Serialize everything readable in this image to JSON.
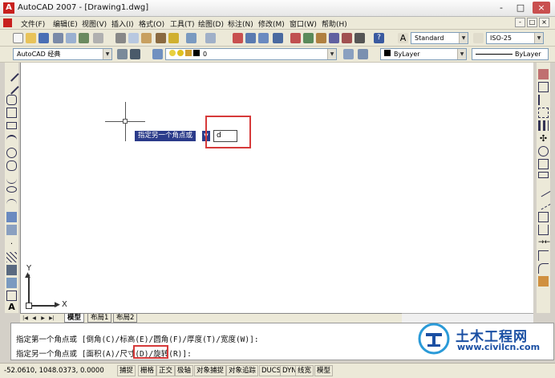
{
  "window": {
    "title": "AutoCAD 2007 - [Drawing1.dwg]",
    "app_icon": "autocad-a-icon",
    "controls": [
      "-",
      "□",
      "×"
    ]
  },
  "menu": {
    "items": [
      "文件(F)",
      "编辑(E)",
      "视图(V)",
      "插入(I)",
      "格式(O)",
      "工具(T)",
      "绘图(D)",
      "标注(N)",
      "修改(M)",
      "窗口(W)",
      "帮助(H)"
    ],
    "doc_controls": [
      "-",
      "□",
      "×"
    ]
  },
  "standard_toolbar": {
    "text_style": "Standard",
    "dim_style": "ISO-25"
  },
  "layers_toolbar": {
    "workspace": "AutoCAD 经典",
    "layer": "0",
    "color": "ByLayer",
    "linetype": "ByLayer"
  },
  "drawing": {
    "prompt_tooltip": "指定另一个角点或",
    "dynamic_input_value": "d"
  },
  "ucs": {
    "x_label": "X",
    "y_label": "Y"
  },
  "tabs": {
    "model": "模型",
    "layout1": "布局1",
    "layout2": "布局2"
  },
  "command": {
    "line1": "指定第一个角点或 [倒角(C)/标高(E)/圆角(F)/厚度(T)/宽度(W)]:",
    "line2_prefix": "指定另一个角点或 [面积(A)/",
    "line2_highlight": "尺寸(D)",
    "line2_suffix": "/旋转(R)]:"
  },
  "status": {
    "coords": "-52.0610,  1048.0373, 0.0000",
    "toggles": [
      "捕捉",
      "栅格",
      "正交",
      "极轴",
      "对象捕捉",
      "对象追踪",
      "DUCS",
      "DYN",
      "线宽",
      "模型"
    ]
  },
  "watermark": {
    "title": "土木工程网",
    "url": "www.civilcn.com"
  },
  "colors": {
    "tooltip_bg": "#2b3b8a",
    "highlight_red": "#d63a3a",
    "watermark_blue": "#1a4fa3"
  }
}
